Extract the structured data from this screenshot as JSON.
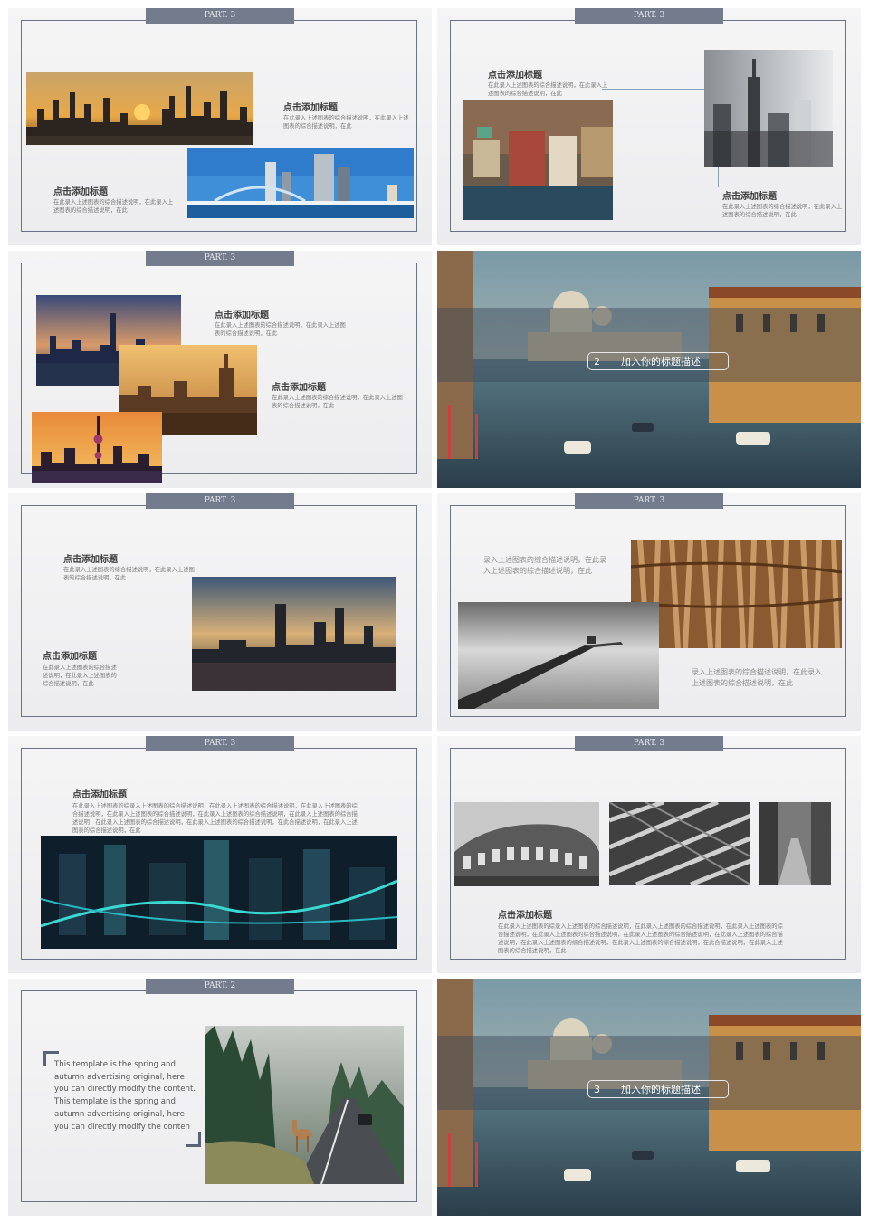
{
  "colors": {
    "frame": "#6b7385",
    "tab": "#737b8d",
    "slide_bg": "#efeff0",
    "overlay": "#3c4656"
  },
  "slides": [
    {
      "part": "PART. 3",
      "blocks": [
        {
          "title": "点击添加标题",
          "desc": "在此录入上述图表的综合描述说明，在此录入上述图表的综合描述说明，在此"
        },
        {
          "title": "点击添加标题",
          "desc": "在此录入上述图表的综合描述说明，在此录入上述图表的综合描述说明，在此"
        }
      ]
    },
    {
      "part": "PART. 3",
      "blocks": [
        {
          "title": "点击添加标题",
          "desc": "在此录入上述图表的综合描述说明，在此录入上述图表的综合描述说明，在此"
        },
        {
          "title": "点击添加标题",
          "desc": "在此录入上述图表的综合描述说明，在此录入上述图表的综合描述说明，在此"
        }
      ]
    },
    {
      "part": "PART. 3",
      "blocks": [
        {
          "title": "点击添加标题",
          "desc": "在此录入上述图表的综合描述说明，在此录入上述图表的综合描述说明，在此"
        },
        {
          "title": "点击添加标题",
          "desc": "在此录入上述图表的综合描述说明，在此录入上述图表的综合描述说明，在此"
        }
      ]
    },
    {
      "number": "2",
      "label": "加入你的标题描述"
    },
    {
      "part": "PART. 3",
      "blocks": [
        {
          "title": "点击添加标题",
          "desc": "在此录入上述图表的综合描述说明，在此录入上述图表的综合描述说明，在此"
        },
        {
          "title": "点击添加标题",
          "desc": "在此录入上述图表的综合描述述说明，在此录入上述图表的综合描述说明，在此"
        }
      ]
    },
    {
      "part": "PART. 3",
      "texts": [
        "录入上述图表的综合描述说明，在此录入上述图表的综合描述说明，在此",
        "录入上述图表的综合描述说明，在此录入上述图表的综合描述说明，在此"
      ]
    },
    {
      "part": "PART. 3",
      "title": "点击添加标题",
      "desc": "在此录入上述图表的综录入上述图表的综合描述说明，在此录入上述图表的综合描述说明，在此录入上述图表的综合描述说明，在此录入上述图表的综合描述说明，在此录入上述图表的综合描述说明，在此录入上述图表的综合描述说明，在此录入上述图表的综合描述说明，在此录入上述图表的综合描述说明，在此合描述说明，在此录入上述图表的综合描述说明，在此"
    },
    {
      "part": "PART. 3",
      "title": "点击添加标题",
      "desc": "在此录入上述图表的综录入上述图表的综合描述说明，在此录入上述图表的综合描述说明，在此录入上述图表的综合描述说明，在此录入上述图表的综合描述说明，在此录入上述图表的综合描述说明，在此录入上述图表的综合描述说明，在此录入上述图表的综合描述说明，在此录入上述图表的综合描述说明，在此合描述说明，在此录入上述图表的综合描述说明，在此"
    },
    {
      "part": "PART. 2",
      "english": "This template is the spring and autumn advertising original, here you can directly modify the content. This template is the spring and autumn advertising original, here you can directly modify the conten"
    },
    {
      "number": "3",
      "label": "加入你的标题描述"
    }
  ]
}
